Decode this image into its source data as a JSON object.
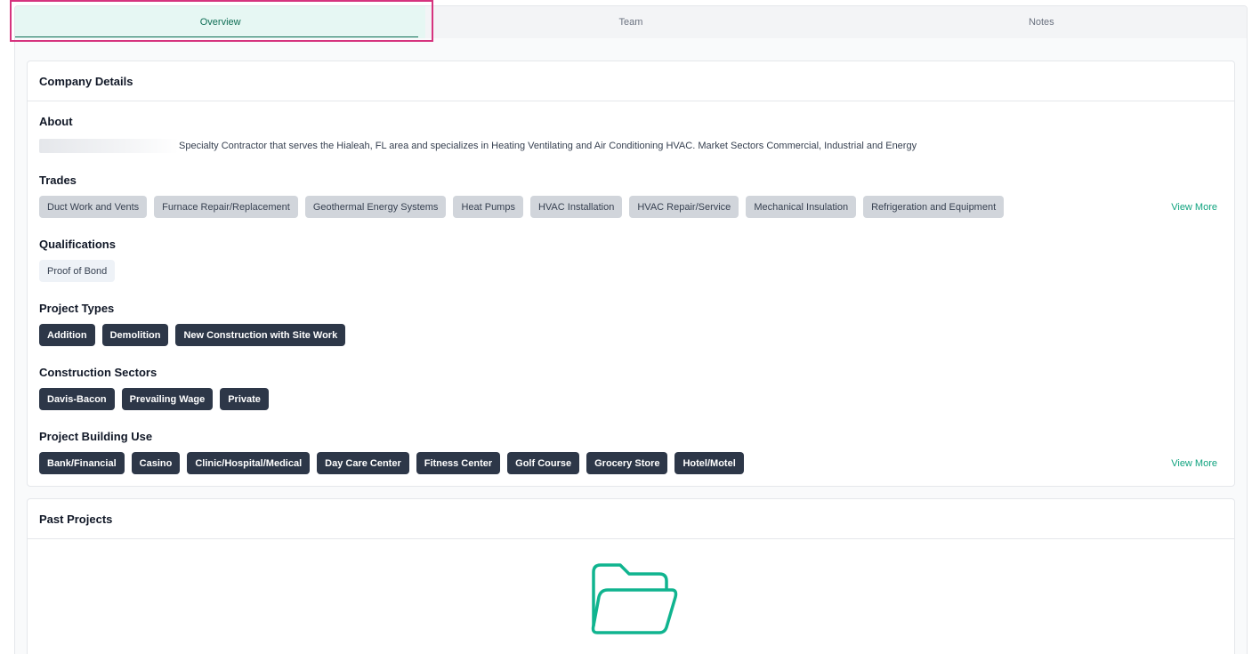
{
  "tabs": [
    {
      "label": "Overview"
    },
    {
      "label": "Team"
    },
    {
      "label": "Notes"
    }
  ],
  "company_details": {
    "title": "Company Details",
    "about": {
      "title": "About",
      "text": "Specialty Contractor that serves the Hialeah, FL area and specializes in Heating Ventilating and Air Conditioning HVAC. Market Sectors Commercial, Industrial and Energy"
    },
    "trades": {
      "title": "Trades",
      "items": [
        "Duct Work and Vents",
        "Furnace Repair/Replacement",
        "Geothermal Energy Systems",
        "Heat Pumps",
        "HVAC Installation",
        "HVAC Repair/Service",
        "Mechanical Insulation",
        "Refrigeration and Equipment"
      ],
      "view_more": "View More"
    },
    "qualifications": {
      "title": "Qualifications",
      "items": [
        "Proof of Bond"
      ]
    },
    "project_types": {
      "title": "Project Types",
      "items": [
        "Addition",
        "Demolition",
        "New Construction with Site Work"
      ]
    },
    "construction_sectors": {
      "title": "Construction Sectors",
      "items": [
        "Davis-Bacon",
        "Prevailing Wage",
        "Private"
      ]
    },
    "project_building_use": {
      "title": "Project Building Use",
      "items": [
        "Bank/Financial",
        "Casino",
        "Clinic/Hospital/Medical",
        "Day Care Center",
        "Fitness Center",
        "Golf Course",
        "Grocery Store",
        "Hotel/Motel"
      ],
      "view_more": "View More"
    }
  },
  "past_projects": {
    "title": "Past Projects",
    "icon": "folder-open-icon"
  },
  "colors": {
    "accent": "#10a37f",
    "active_tab_bg": "#e6f7f3",
    "dark_chip": "#2d3748",
    "highlight": "#d6337e"
  }
}
